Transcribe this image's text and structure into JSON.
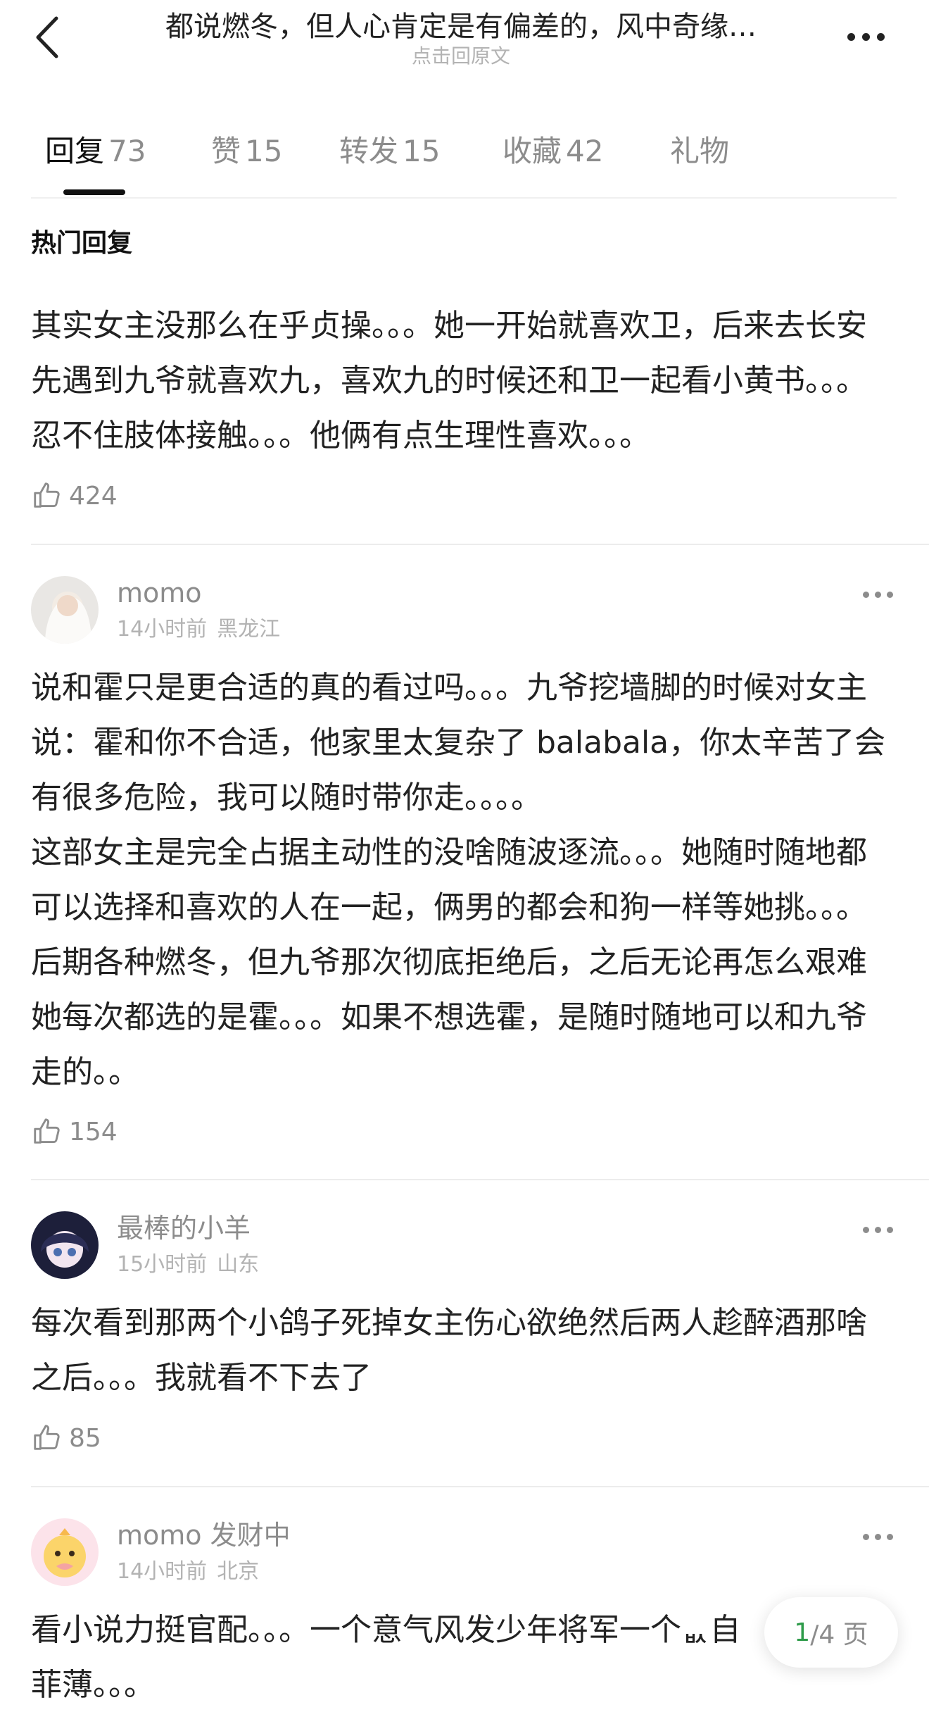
{
  "header": {
    "title": "都说燃冬，但人心肯定是有偏差的，风中奇缘…",
    "subtitle": "点击回原文"
  },
  "tabs": [
    {
      "label": "回复",
      "count": "73"
    },
    {
      "label": "赞",
      "count": "15"
    },
    {
      "label": "转发",
      "count": "15"
    },
    {
      "label": "收藏",
      "count": "42"
    },
    {
      "label": "礼物",
      "count": ""
    }
  ],
  "section_title": "热门回复",
  "hot_comment": {
    "text": "其实女主没那么在乎贞操。。。她一开始就喜欢卫，后来去长安先遇到九爷就喜欢九，喜欢九的时候还和卫一起看小黄书。。。忍不住肢体接触。。。他俩有点生理性喜欢。。。",
    "likes": "424"
  },
  "comments": [
    {
      "username": "momo",
      "time": "14小时前",
      "location": "黑龙江",
      "text": "说和霍只是更合适的真的看过吗。。。九爷挖墙脚的时候对女主说：霍和你不合适，他家里太复杂了 balabala，你太辛苦了会有很多危险，我可以随时带你走。。。。\n这部女主是完全占据主动性的没啥随波逐流。。。她随时随地都可以选择和喜欢的人在一起，俩男的都会和狗一样等她挑。。。后期各种燃冬，但九爷那次彻底拒绝后，之后无论再怎么艰难她每次都选的是霍。。。如果不想选霍，是随时随地可以和九爷走的。。",
      "likes": "154"
    },
    {
      "username": "最棒的小羊",
      "time": "15小时前",
      "location": "山东",
      "text": "每次看到那两个小鸽子死掉女主伤心欲绝然后两人趁醉酒那啥之后。。。我就看不下去了",
      "likes": "85"
    },
    {
      "username": "momo 发财中",
      "time": "14小时前",
      "location": "北京",
      "text": "看小说力挺官配。。。一个意气风发少年将军一个ᆹ自菲薄。。。",
      "likes": ""
    }
  ],
  "pager": {
    "current": "1",
    "total": "/4 页"
  },
  "colors": {
    "accent_green": "#2e9b4a",
    "muted": "#8c8c8c"
  }
}
